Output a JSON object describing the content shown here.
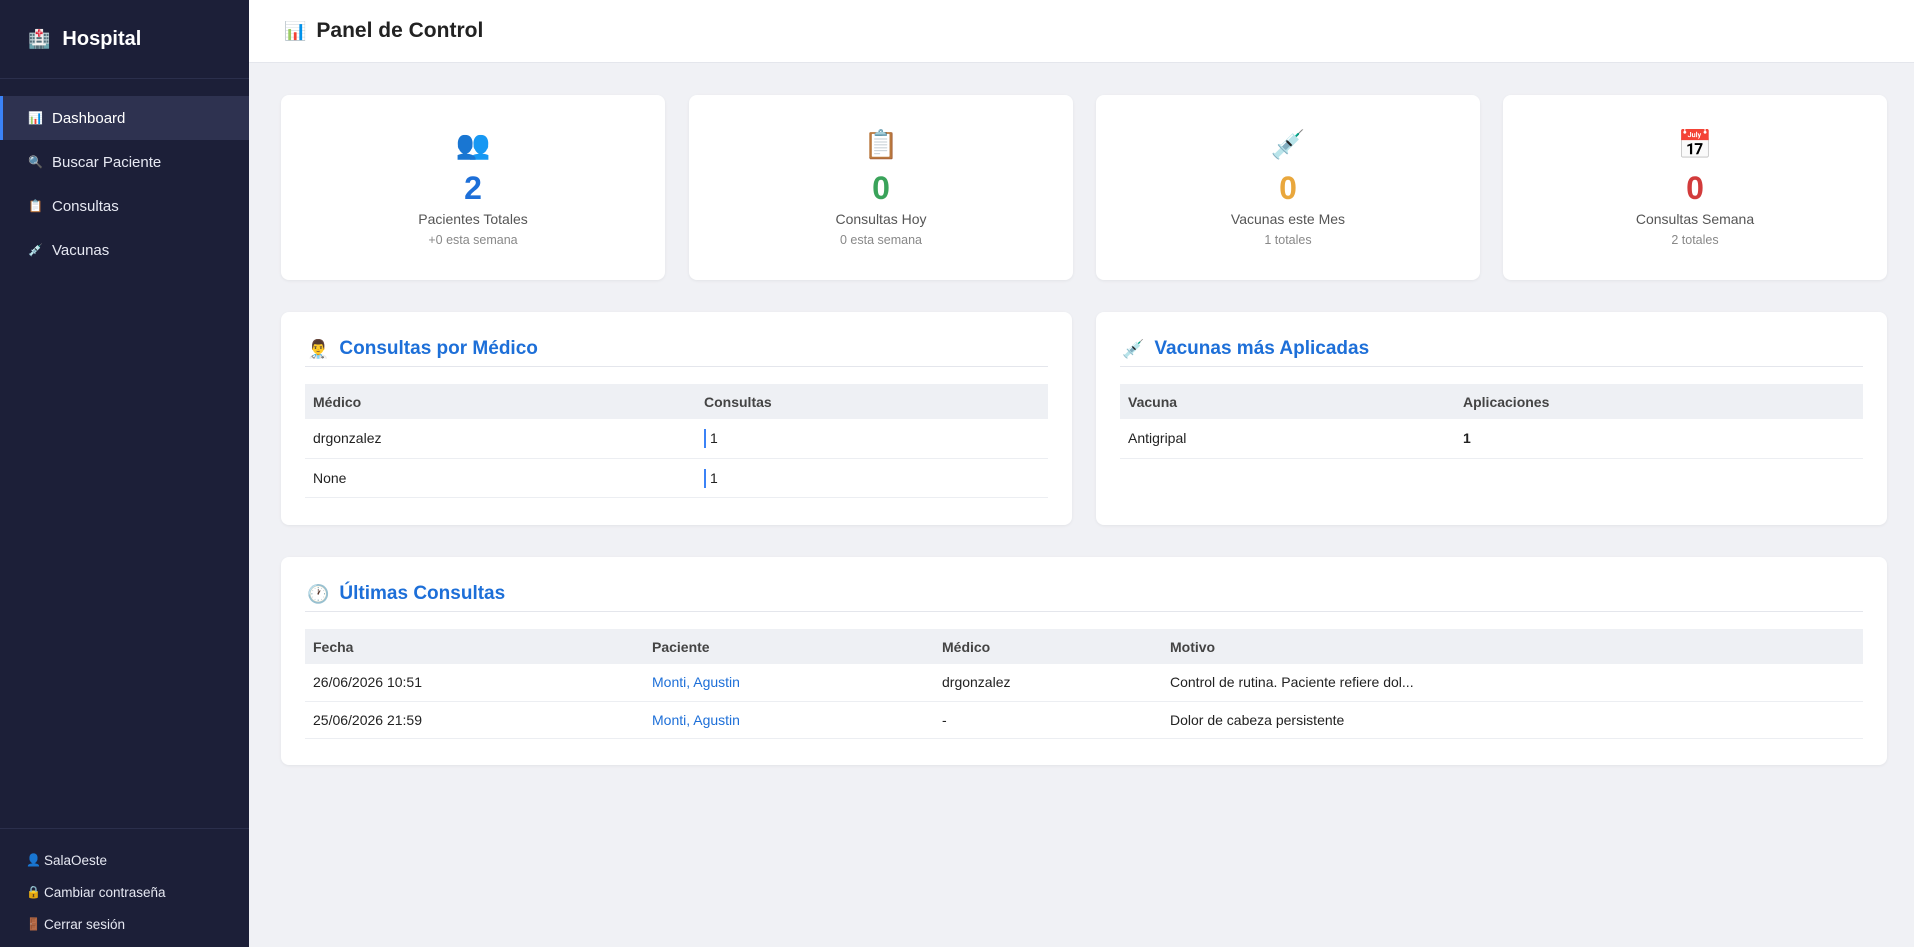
{
  "sidebar": {
    "brand": "Hospital",
    "brand_icon": "🏥",
    "items": [
      {
        "label": "Dashboard",
        "icon": "📊"
      },
      {
        "label": "Buscar Paciente",
        "icon": "🔍"
      },
      {
        "label": "Consultas",
        "icon": "📋"
      },
      {
        "label": "Vacunas",
        "icon": "💉"
      }
    ],
    "footer": [
      {
        "label": "SalaOeste",
        "icon": "👤"
      },
      {
        "label": "Cambiar contraseña",
        "icon": "🔒"
      },
      {
        "label": "Cerrar sesión",
        "icon": "🚪"
      }
    ]
  },
  "header": {
    "title": "Panel de Control",
    "icon": "📊"
  },
  "stats": [
    {
      "icon": "👥",
      "value": "2",
      "label": "Pacientes Totales",
      "sub": "+0 esta semana",
      "color": "#1d6fd8"
    },
    {
      "icon": "📋",
      "value": "0",
      "label": "Consultas Hoy",
      "sub": "0 esta semana",
      "color": "#3aa35a"
    },
    {
      "icon": "💉",
      "value": "0",
      "label": "Vacunas este Mes",
      "sub": "1 totales",
      "color": "#e9a73c"
    },
    {
      "icon": "📅",
      "value": "0",
      "label": "Consultas Semana",
      "sub": "2 totales",
      "color": "#d23b3b"
    }
  ],
  "consultas_medico": {
    "title": "Consultas por Médico",
    "icon": "👨‍⚕️",
    "headers": [
      "Médico",
      "Consultas"
    ],
    "rows": [
      {
        "medico": "drgonzalez",
        "consultas": "1"
      },
      {
        "medico": "None",
        "consultas": "1"
      }
    ]
  },
  "vacunas": {
    "title": "Vacunas más Aplicadas",
    "icon": "💉",
    "headers": [
      "Vacuna",
      "Aplicaciones"
    ],
    "rows": [
      {
        "vacuna": "Antigripal",
        "aplicaciones": "1"
      }
    ]
  },
  "ultimas": {
    "title": "Últimas Consultas",
    "icon": "🕐",
    "headers": [
      "Fecha",
      "Paciente",
      "Médico",
      "Motivo"
    ],
    "rows": [
      {
        "fecha": "26/06/2026 10:51",
        "paciente": "Monti, Agustin",
        "medico": "drgonzalez",
        "motivo": "Control de rutina. Paciente refiere dol..."
      },
      {
        "fecha": "25/06/2026 21:59",
        "paciente": "Monti, Agustin",
        "medico": "-",
        "motivo": "Dolor de cabeza persistente"
      }
    ]
  }
}
